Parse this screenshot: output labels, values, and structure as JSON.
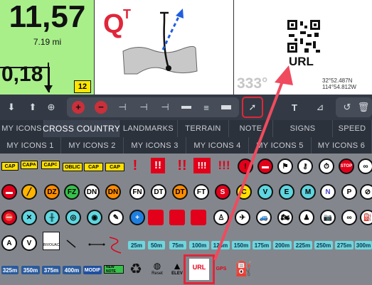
{
  "dashboard": {
    "speed_value": "11,57",
    "distance_label": "7.19 mi",
    "odo_value": "0,18",
    "badge_value": "12"
  },
  "tulip": {
    "q_letter": "Q",
    "q_sup": "T"
  },
  "qr_panel": {
    "url_label": "URL",
    "heading": "333°",
    "coords_line1": "32°52.487N",
    "coords_line2": "114°54.812W"
  },
  "toolbar_icons": [
    "arrow-down-icon",
    "arrow-up-icon",
    "target-icon",
    "add-icon",
    "remove-icon",
    "line-short-icon",
    "line-medium-icon",
    "line-long-icon",
    "line-wide-icon",
    "line-dashed-icon",
    "line-thick-icon",
    "pointer-icon",
    "text-icon",
    "ruler-icon",
    "undo-icon",
    "trash-icon"
  ],
  "tabs_row1": [
    "MY ICONS",
    "CROSS COUNTRY",
    "LANDMARKS",
    "TERRAIN",
    "NOTE",
    "SIGNS",
    "SPEED"
  ],
  "tabs_row2": [
    "MY ICONS 1",
    "MY ICONS 2",
    "MY ICONS 3",
    "MY ICONS 4",
    "MY ICONS 5",
    "MY ICONS 6"
  ],
  "active_tab": "CROSS COUNTRY",
  "row1_chips": [
    "CAP",
    "CAP",
    "CAP",
    "OBLIC",
    "CAP",
    "CAP"
  ],
  "row1_chip_subs": [
    "",
    "A",
    "C",
    "",
    "",
    ""
  ],
  "row1_excl": [
    "!",
    "!!",
    "!!",
    "!!!",
    "!!!"
  ],
  "row2_circles": [
    "DZ",
    "FZ",
    "DN",
    "DN",
    "FN",
    "DT",
    "DT",
    "FT",
    "S",
    "C",
    "V",
    "E",
    "M",
    "N",
    "P"
  ],
  "row4_letters": [
    "A",
    "V"
  ],
  "row4_bivouac": "BIVOUAC",
  "distances_row4": [
    "25m",
    "50m",
    "75m",
    "100m",
    "125m",
    "150m",
    "175m",
    "200m",
    "225m",
    "250m",
    "275m",
    "300m"
  ],
  "distances_row5": [
    "325m",
    "350m",
    "375m",
    "400m"
  ],
  "modif_label": "MODIF",
  "new_note_label": "NEW NOTE",
  "reset_label": "Reset",
  "elev_label": "ELEV",
  "url_small": "URL",
  "gps_small": "GPS",
  "colors": {
    "accent_red": "#e0273a",
    "green_panel": "#a8ef8a",
    "toolbar": "#333a45",
    "distance_chip": "#6fd6dc"
  }
}
